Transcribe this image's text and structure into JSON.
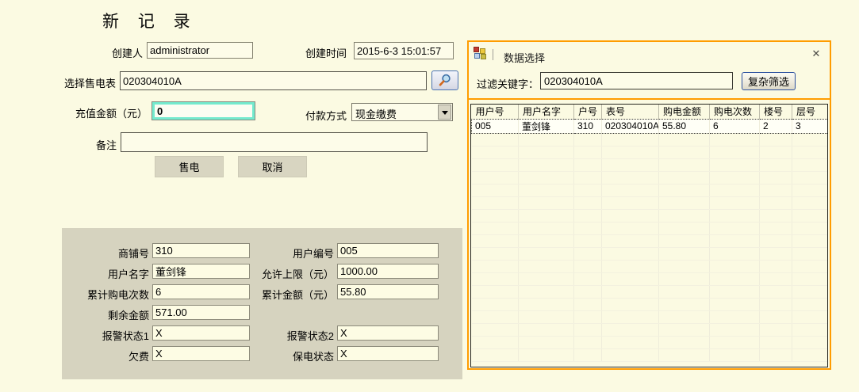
{
  "page": {
    "title": "新 记 录"
  },
  "form": {
    "creator": {
      "label": "创建人",
      "value": "administrator"
    },
    "created_time": {
      "label": "创建时间",
      "value": "2015-6-3 15:01:57"
    },
    "meter": {
      "label": "选择售电表",
      "value": "020304010A"
    },
    "amount": {
      "label": "充值金额（元）",
      "value": "0"
    },
    "payment": {
      "label": "付款方式",
      "value": "现金缴费"
    },
    "remark": {
      "label": "备注",
      "value": ""
    },
    "sell_label": "售电",
    "cancel_label": "取消"
  },
  "details": {
    "rows": [
      {
        "left": {
          "label": "商铺号",
          "value": "310"
        },
        "right": {
          "label": "用户编号",
          "value": "005"
        }
      },
      {
        "left": {
          "label": "用户名字",
          "value": "董剑锋"
        },
        "right": {
          "label": "允许上限（元）",
          "value": "1000.00"
        }
      },
      {
        "left": {
          "label": "累计购电次数",
          "value": "6"
        },
        "right": {
          "label": "累计金额（元）",
          "value": "55.80"
        }
      },
      {
        "left": {
          "label": "剩余金额",
          "value": "571.00"
        }
      },
      {
        "left": {
          "label": "报警状态1",
          "value": "X"
        },
        "right": {
          "label": "报警状态2",
          "value": "X"
        }
      },
      {
        "left": {
          "label": "欠费",
          "value": "X"
        },
        "right": {
          "label": "保电状态",
          "value": "X"
        }
      }
    ]
  },
  "panel": {
    "title": "数据选择",
    "filter_label": "过滤关键字：",
    "filter_value": "020304010A",
    "filter_button": "复杂筛选",
    "table": {
      "columns": [
        "用户号",
        "用户名字",
        "户号",
        "表号",
        "购电金额",
        "购电次数",
        "楼号",
        "层号"
      ],
      "rows": [
        [
          "005",
          "董剑锋",
          "310",
          "020304010A",
          "55.80",
          "6",
          "2",
          "3"
        ]
      ],
      "empty_row_count": 18
    }
  },
  "icons": {
    "close_glyph": "✕",
    "search": "magnifier-icon",
    "dropdown": "chevron-down-icon",
    "panel": "form-window-icon"
  },
  "colors": {
    "background": "#FBFAE2",
    "panel_gray": "#D6D3BF",
    "accent_orange": "#FF9C00",
    "highlight_aqua": "#74EACE",
    "input_bg": "#FDFCE9",
    "grid_border": "#26261F",
    "selected_row_bg": "#FFFFF6"
  }
}
